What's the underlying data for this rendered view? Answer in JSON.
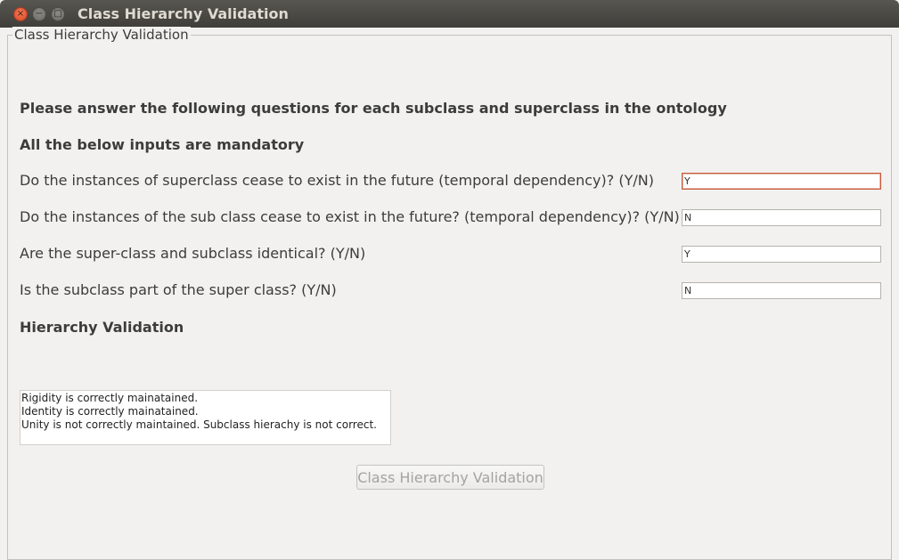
{
  "window": {
    "title": "Class Hierarchy Validation",
    "controls": {
      "close_icon": "×",
      "minimize_icon": "−",
      "maximize_icon": "□"
    }
  },
  "panel": {
    "legend": "Class Hierarchy Validation",
    "instruction": "Please answer the following questions for each subclass and superclass in the ontology",
    "mandatory_note": "All the below inputs are mandatory",
    "questions": [
      {
        "label": "Do the instances of superclass cease to exist in the future (temporal dependency)? (Y/N)",
        "value": "Y"
      },
      {
        "label": "Do the instances of the sub class cease to exist in the future? (temporal dependency)? (Y/N)",
        "value": "N"
      },
      {
        "label": "Are the super-class and subclass identical? (Y/N)",
        "value": "Y"
      },
      {
        "label": "Is the subclass part of the super class? (Y/N)",
        "value": "N"
      }
    ],
    "section_heading": "Hierarchy Validation",
    "results": [
      "Rigidity is correctly mainatained.",
      "Identity is correctly mainatained.",
      "Unity is not correctly maintained. Subclass hierachy is not correct."
    ],
    "button_label": "Class Hierarchy Validation"
  }
}
